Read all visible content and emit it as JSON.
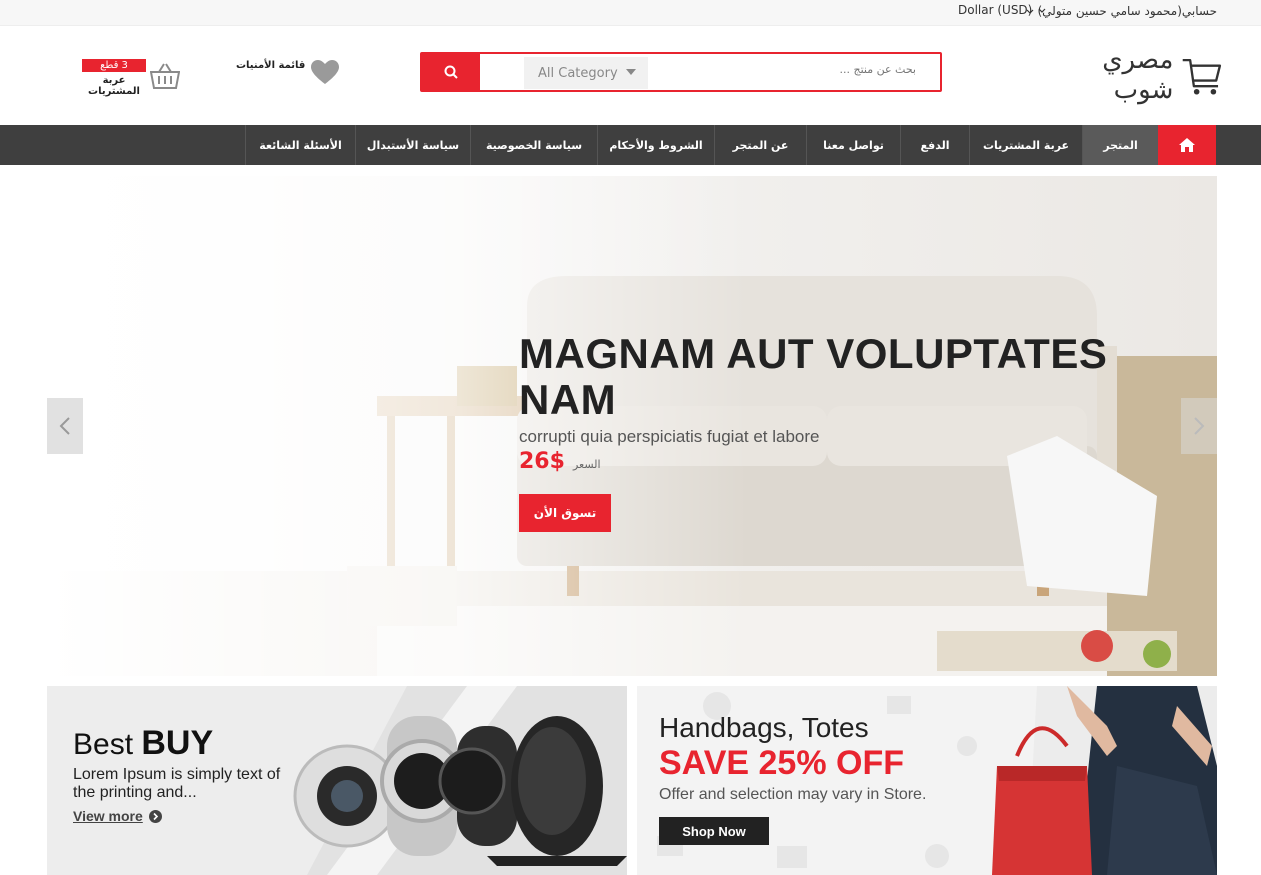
{
  "topbar": {
    "account": "حسابي(محمود سامي حسين متولي)",
    "currency": "Dollar (USD)"
  },
  "header": {
    "logo_text": "مصري شوب",
    "search": {
      "category": "All Category",
      "placeholder": "بحث عن منتج ..."
    },
    "wishlist_label": "قائمة الأمنيات",
    "cart": {
      "count": "3 قطع",
      "label": "عربة المشتريات"
    }
  },
  "nav": {
    "items": [
      {
        "label": "المتجر"
      },
      {
        "label": "عربة المشتريات"
      },
      {
        "label": "الدفع"
      },
      {
        "label": "تواصل معنا"
      },
      {
        "label": "عن المتجر"
      },
      {
        "label": "الشروط والأحكام"
      },
      {
        "label": "سياسة الخصوصية"
      },
      {
        "label": "سياسة الأستبدال"
      },
      {
        "label": "الأسئلة الشائعة"
      }
    ]
  },
  "slider": {
    "title": "MAGNAM AUT VOLUPTATES NAM",
    "subtitle": "corrupti quia perspiciatis fugiat et labore",
    "price_label": "السعر",
    "price": "26$",
    "button": "تسوق الأن"
  },
  "banner_left": {
    "title_light": "Best ",
    "title_bold": "BUY",
    "description": "Lorem Ipsum is simply text of the printing and...",
    "link": "View more"
  },
  "banner_right": {
    "title": "Handbags, Totes",
    "save": "SAVE 25% OFF",
    "offer": "Offer and selection may vary in Store.",
    "button": "Shop Now"
  },
  "colors": {
    "accent": "#e8242f",
    "nav_bg": "#3f3f3f"
  },
  "icons": [
    "home-icon",
    "search-icon",
    "heart-icon",
    "basket-icon",
    "cart-logo-icon",
    "chevron-left-icon",
    "chevron-right-icon",
    "arrow-circle-right-icon",
    "chevron-down-icon"
  ]
}
